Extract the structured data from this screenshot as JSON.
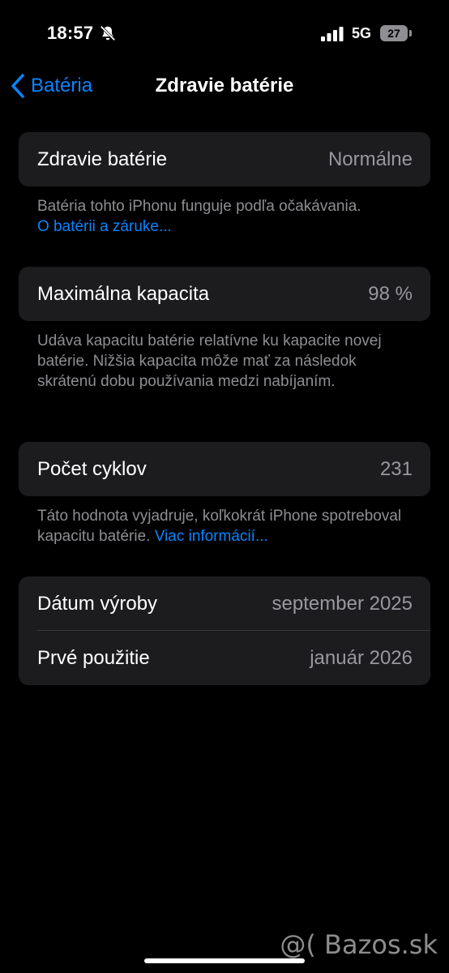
{
  "status_bar": {
    "time": "18:57",
    "network": "5G",
    "battery_level": "27",
    "icons": [
      "bell-slash-icon",
      "signal-icon",
      "battery-icon"
    ]
  },
  "nav": {
    "back_label": "Batéria",
    "title": "Zdravie batérie"
  },
  "health": {
    "label": "Zdravie batérie",
    "value": "Normálne",
    "footer_text": "Batéria tohto iPhonu funguje podľa očakávania.",
    "footer_link": "O batérii a záruke..."
  },
  "capacity": {
    "label": "Maximálna kapacita",
    "value": "98 %",
    "footer_text": "Udáva kapacitu batérie relatívne ku kapacite novej batérie. Nižšia kapacita môže mať za následok skrátenú dobu používania medzi nabíjaním."
  },
  "cycles": {
    "label": "Počet cyklov",
    "value": "231",
    "footer_text": "Táto hodnota vyjadruje, koľkokrát iPhone spotreboval kapacitu batérie. ",
    "footer_link": "Viac informácií..."
  },
  "dates": {
    "manufacture_label": "Dátum výroby",
    "manufacture_value": "september 2025",
    "first_use_label": "Prvé použitie",
    "first_use_value": "január 2026"
  },
  "watermark": "@( Bazos.sk",
  "colors": {
    "background": "#000000",
    "group": "#1c1c1e",
    "accent": "#0a84ff",
    "secondary_text": "#98989f"
  }
}
